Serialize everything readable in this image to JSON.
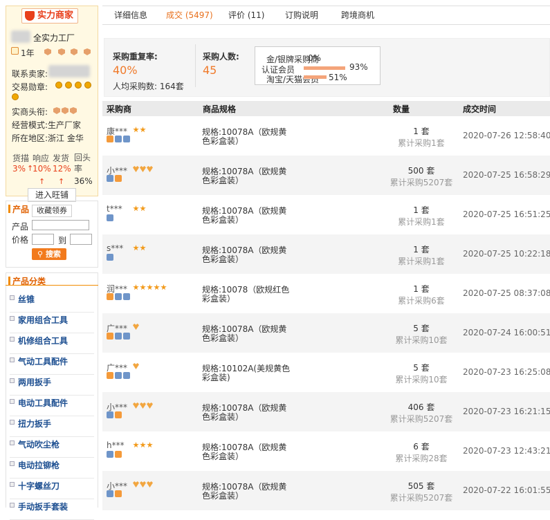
{
  "seller": {
    "badge": "实力商家",
    "shop_name": "全实力工厂",
    "years": "1年",
    "contact_label": "联系卖家:",
    "medal_label": "交易勋章:",
    "title_label": "实商头衔:",
    "mode_label": "经营模式:",
    "mode_value": "生产厂家",
    "region_label": "所在地区:",
    "region_value": "浙江 金华",
    "metrics": [
      {
        "label": "货描",
        "value": "3%"
      },
      {
        "label": "响应",
        "value": "10%"
      },
      {
        "label": "发货",
        "value": "12%"
      },
      {
        "label": "回头率",
        "value": "36%"
      }
    ],
    "arrow": "↑",
    "wangwang_label": "进入旺铺",
    "coupon_label": "收藏领券"
  },
  "search": {
    "title": "产品",
    "product_label": "产品",
    "price_label": "价格",
    "to_label": "到",
    "button_label": "搜索"
  },
  "categories": {
    "title": "产品分类",
    "items": [
      "丝锥",
      "家用组合工具",
      "机修组合工具",
      "气动工具配件",
      "两用扳手",
      "电动工具配件",
      "扭力扳手",
      "气动吹尘枪",
      "电动拉铆枪",
      "十字螺丝刀",
      "手动扳手套装"
    ]
  },
  "tabs": [
    "详细信息",
    "成交 (5497)",
    "评价 (11)",
    "订购说明",
    "跨境商机"
  ],
  "stats": {
    "rebuy_label": "采购重复率:",
    "rebuy_value": "40%",
    "avg_label": "人均采购数:",
    "avg_value": "164套",
    "buyers_label": "采购人数:",
    "buyers_value": "45",
    "popover": [
      {
        "label": "金/银牌采购商",
        "value": "0%",
        "fraction": 0.0
      },
      {
        "label": "认证会员",
        "value": "93%",
        "fraction": 0.93
      },
      {
        "label": "淘宝/天猫会员",
        "value": "51%",
        "fraction": 0.51
      }
    ]
  },
  "table": {
    "headers": [
      "采购商",
      "商品规格",
      "数量",
      "成交时间"
    ],
    "rows": [
      {
        "buyer": "康***",
        "level_type": "star",
        "level_count": 2,
        "spec": "规格:10078A（欧规黄色彩盒装）",
        "qty": "1 套",
        "total": "累计采购1套",
        "time": "2020-07-26 12:58:40",
        "icons": [
          "orange",
          "blue",
          "blue"
        ]
      },
      {
        "buyer": "小***",
        "level_type": "heart",
        "level_count": 3,
        "spec": "规格:10078A（欧规黄色彩盒装）",
        "qty": "500 套",
        "total": "累计采购5207套",
        "time": "2020-07-25 16:58:29",
        "icons": [
          "blue",
          "orange"
        ]
      },
      {
        "buyer": "t***",
        "level_type": "star",
        "level_count": 2,
        "spec": "规格:10078A（欧规黄色彩盒装）",
        "qty": "1 套",
        "total": "累计采购1套",
        "time": "2020-07-25 16:51:25",
        "icons": [
          "blue"
        ]
      },
      {
        "buyer": "s***",
        "level_type": "star",
        "level_count": 2,
        "spec": "规格:10078A（欧规黄色彩盒装）",
        "qty": "1 套",
        "total": "累计采购1套",
        "time": "2020-07-25 10:22:18",
        "icons": [
          "blue"
        ]
      },
      {
        "buyer": "润***",
        "level_type": "star",
        "level_count": 5,
        "spec": "规格:10078（欧规红色彩盒装）",
        "qty": "1 套",
        "total": "累计采购6套",
        "time": "2020-07-25 08:37:08",
        "icons": [
          "orange",
          "blue",
          "blue"
        ]
      },
      {
        "buyer": "广***",
        "level_type": "heart",
        "level_count": 1,
        "spec": "规格:10078A（欧规黄色彩盒装）",
        "qty": "5 套",
        "total": "累计采购10套",
        "time": "2020-07-24 16:00:51",
        "icons": [
          "orange",
          "blue",
          "blue"
        ]
      },
      {
        "buyer": "广***",
        "level_type": "heart",
        "level_count": 1,
        "spec": "规格:10102A(美规黄色彩盒装)",
        "qty": "5 套",
        "total": "累计采购10套",
        "time": "2020-07-23 16:25:08",
        "icons": [
          "orange",
          "blue",
          "blue"
        ]
      },
      {
        "buyer": "小***",
        "level_type": "heart",
        "level_count": 3,
        "spec": "规格:10078A（欧规黄色彩盒装）",
        "qty": "406 套",
        "total": "累计采购5207套",
        "time": "2020-07-23 16:21:15",
        "icons": [
          "blue",
          "orange"
        ]
      },
      {
        "buyer": "h***",
        "level_type": "star",
        "level_count": 3,
        "spec": "规格:10078A（欧规黄色彩盒装）",
        "qty": "6 套",
        "total": "累计采购28套",
        "time": "2020-07-23 12:43:21",
        "icons": [
          "blue",
          "orange"
        ]
      },
      {
        "buyer": "小***",
        "level_type": "heart",
        "level_count": 3,
        "spec": "规格:10078A（欧规黄色彩盒装）",
        "qty": "505 套",
        "total": "累计采购5207套",
        "time": "2020-07-22 16:01:55",
        "icons": [
          "blue",
          "orange"
        ]
      }
    ]
  }
}
